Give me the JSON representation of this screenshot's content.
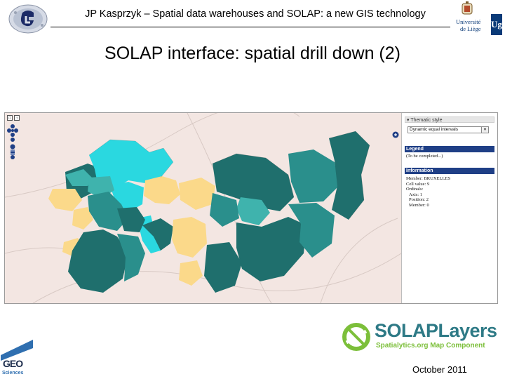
{
  "header": {
    "title": "JP Kasprzyk – Spatial data warehouses and SOLAP: a new GIS technology",
    "university_line1": "Université",
    "university_line2": "de Liège",
    "university_mark": "Ug"
  },
  "slide": {
    "title": "SOLAP interface: spatial drill down (2)"
  },
  "app": {
    "thematic": {
      "header": "Thematic style",
      "selected": "Dynamic equal intervals"
    },
    "legend": {
      "header": "Legend",
      "text": "(To be completed...)"
    },
    "information": {
      "header": "Information",
      "lines": [
        "Member: BRUXELLES",
        "Cell value: 9",
        "Ordinals:",
        "Axis: 1",
        "Position: 2",
        "Member: 0"
      ]
    },
    "map_colors": {
      "background": "#f3e6e2",
      "dark_teal": "#1f6f6d",
      "mid_teal": "#2a8f8c",
      "light_teal": "#3fb3ad",
      "cyan": "#2ad8e0",
      "yellow": "#fbd98a"
    },
    "icons": {
      "pan": "pan-compass-icon",
      "zoom": "zoom-bar-icon",
      "layers": "layer-switcher-icon"
    }
  },
  "footer": {
    "geo_logo_text_top": "GEO",
    "geo_logo_text_bottom": "Sciences",
    "solaplayers_name": "SOLAPLayers",
    "solaplayers_tagline": "Spatialytics.org Map Component",
    "date": "October 2011"
  }
}
